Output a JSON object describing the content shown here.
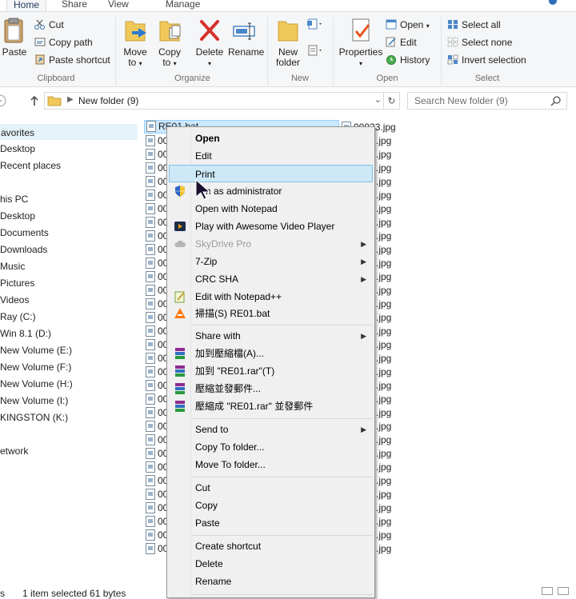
{
  "ribbon_tabs": {
    "home": "Home",
    "share": "Share",
    "view": "View",
    "manage": "Manage"
  },
  "ribbon": {
    "clipboard": {
      "label": "Clipboard",
      "paste": "Paste",
      "cut": "Cut",
      "copy_path": "Copy path",
      "paste_shortcut": "Paste shortcut"
    },
    "organize": {
      "label": "Organize",
      "move_to": "Move",
      "move_to_2": "to",
      "copy_to": "Copy",
      "copy_to_2": "to",
      "delete": "Delete",
      "rename": "Rename"
    },
    "new": {
      "label": "New",
      "new_folder": "New",
      "new_folder_2": "folder"
    },
    "open": {
      "label": "Open",
      "properties": "Properties",
      "open": "Open",
      "edit": "Edit",
      "history": "History"
    },
    "select": {
      "label": "Select",
      "select_all": "Select all",
      "select_none": "Select none",
      "invert": "Invert selection"
    }
  },
  "address": {
    "path": "New folder (9)",
    "search_placeholder": "Search New folder (9)"
  },
  "nav": [
    {
      "label": "avorites"
    },
    {
      "label": "Desktop"
    },
    {
      "label": "Recent places"
    },
    {
      "label": "his PC"
    },
    {
      "label": "Desktop"
    },
    {
      "label": "Documents"
    },
    {
      "label": "Downloads"
    },
    {
      "label": "Music"
    },
    {
      "label": "Pictures"
    },
    {
      "label": "Videos"
    },
    {
      "label": "Ray (C:)"
    },
    {
      "label": "Win 8.1 (D:)"
    },
    {
      "label": "New Volume (E:)"
    },
    {
      "label": "New Volume (F:)"
    },
    {
      "label": "New Volume (H:)"
    },
    {
      "label": "New Volume (I:)"
    },
    {
      "label": "KINGSTON (K:)"
    },
    {
      "label": "etwork"
    }
  ],
  "files": {
    "selected": "RE01.bat",
    "col1_prefix": "00",
    "col2": [
      "00023.jpg",
      ".jpg",
      ".jpg",
      ".jpg",
      ".jpg",
      ".jpg",
      ".jpg",
      ".jpg",
      ".jpg",
      ".jpg",
      ".jpg",
      ".jpg",
      ".jpg",
      ".jpg",
      ".jpg",
      ".jpg",
      ".jpg",
      ".jpg",
      ".jpg",
      ".jpg",
      ".jpg",
      ".jpg",
      ".jpg",
      ".jpg",
      ".jpg",
      ".jpg",
      ".jpg",
      ".jpg",
      ".jpg",
      ".jpg",
      ".jpg",
      ".jpg"
    ]
  },
  "context_menu": {
    "open": "Open",
    "edit": "Edit",
    "print": "Print",
    "run_admin": "n as administrator",
    "open_notepad": "Open with Notepad",
    "play_awesome": "Play with Awesome Video Player",
    "skydrive": "SkyDrive Pro",
    "zip7": "7-Zip",
    "crc_sha": "CRC SHA",
    "edit_npp": "Edit with Notepad++",
    "scan": "掃描(S) RE01.bat",
    "share_with": "Share with",
    "rar_add": "加到壓縮檔(A)...",
    "rar_add_name": "加到 \"RE01.rar\"(T)",
    "rar_mail": "壓縮並發郵件...",
    "rar_mail_name": "壓縮成 \"RE01.rar\" 並發郵件",
    "send_to": "Send to",
    "copy_to_folder": "Copy To folder...",
    "move_to_folder": "Move To folder...",
    "cut": "Cut",
    "copy": "Copy",
    "paste": "Paste",
    "create_shortcut": "Create shortcut",
    "delete": "Delete",
    "rename": "Rename"
  },
  "status": {
    "count_prefix": "s",
    "selected": "1 item selected  61 bytes"
  }
}
